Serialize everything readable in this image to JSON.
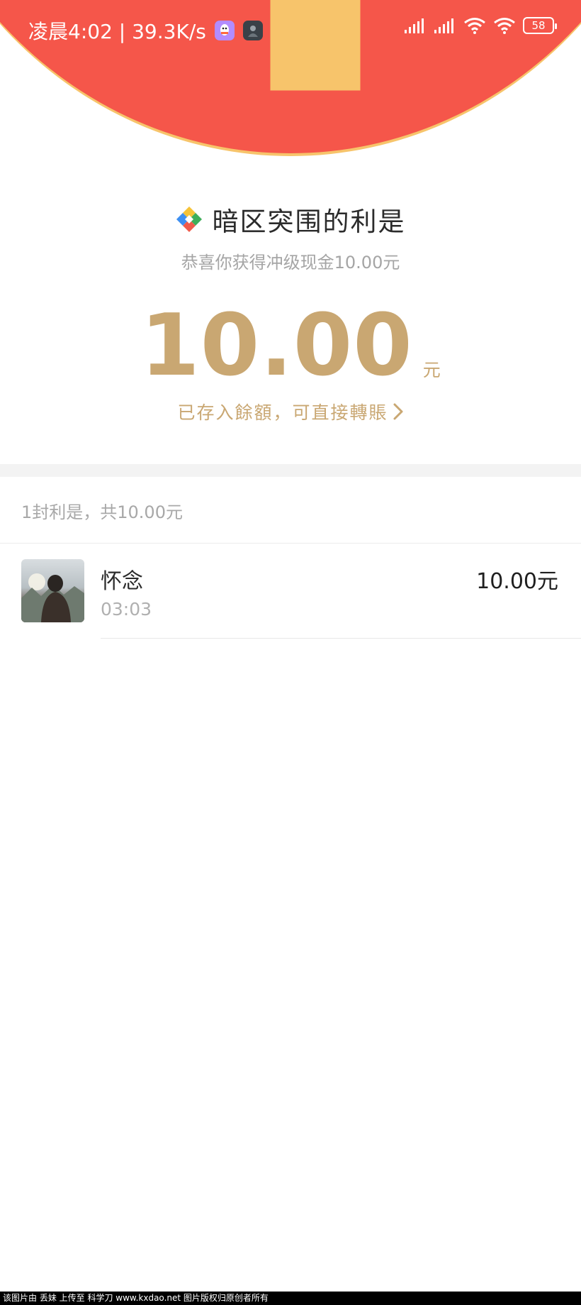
{
  "status_bar": {
    "time_speed": "凌晨4:02 | 39.3K/s",
    "battery": "58",
    "icons": [
      "qq-icon",
      "game-avatar-icon",
      "signal-icon",
      "signal-icon",
      "wifi-icon",
      "wifi-icon",
      "battery-icon"
    ]
  },
  "nav": {
    "back_icon": "chevron-left-icon",
    "more_icon": "more-dots-icon"
  },
  "packet": {
    "sender_name": "暗区突围的利是",
    "subtitle": "恭喜你获得冲级现金10.00元",
    "amount": "10.00",
    "unit": "元",
    "saved_link": "已存入餘額，可直接轉賬"
  },
  "summary": "1封利是，共10.00元",
  "records": [
    {
      "name": "怀念",
      "time": "03:03",
      "amount": "10.00元"
    }
  ],
  "watermark": "该图片由 丢妹 上传至 科学刀 www.kxdao.net 图片版权归原创者所有",
  "colors": {
    "header_red": "#f5564a",
    "header_border": "#f7c46b",
    "gold": "#c9a772"
  }
}
